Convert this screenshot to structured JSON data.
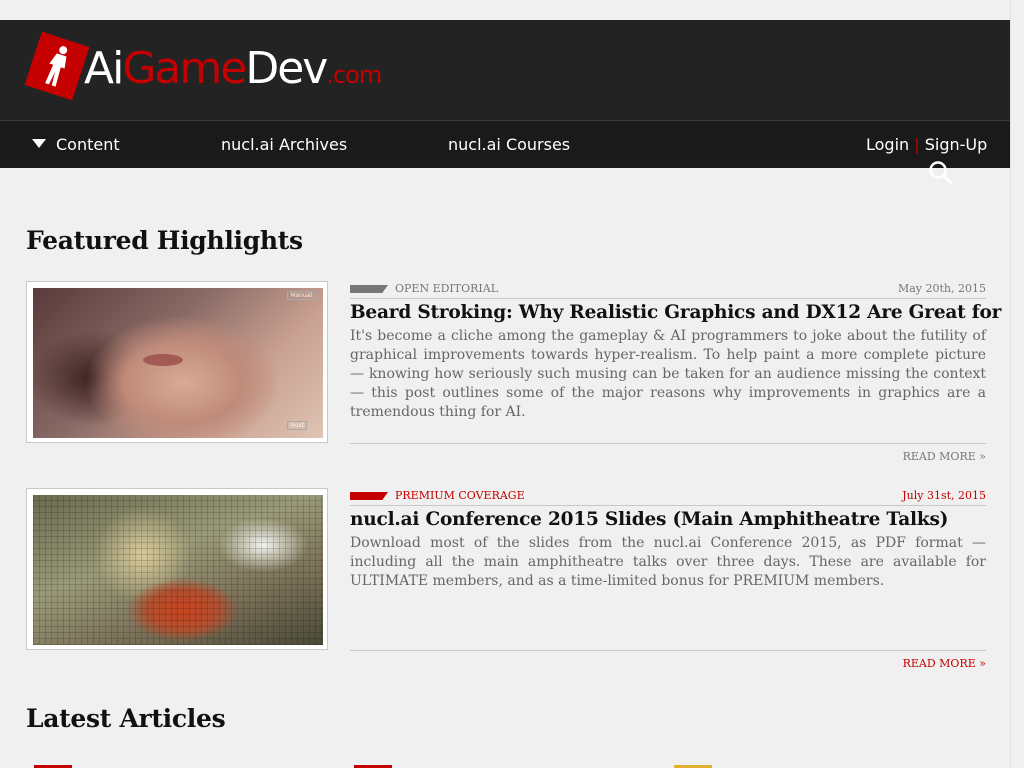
{
  "colors": {
    "brand_red": "#c40000",
    "header_bg": "#232323",
    "nav_bg": "#1a1a1a",
    "page_bg": "#f0f0f0",
    "editorial_gray": "#777777",
    "premium_red": "#c40000"
  },
  "logo": {
    "ai": "Ai",
    "game": "Game",
    "dev": "Dev",
    "com": ".com",
    "icon": "runner-figure-icon"
  },
  "nav": {
    "content": "Content",
    "archives": "nucl.ai Archives",
    "courses": "nucl.ai Courses",
    "login": "Login",
    "separator": "|",
    "signup": "Sign-Up",
    "search_icon": "search-icon"
  },
  "featured": {
    "heading": "Featured Highlights",
    "articles": [
      {
        "category": "OPEN EDITORIAL",
        "date": "May 20th, 2015",
        "title": "Beard Stroking: Why Realistic Graphics and DX12 Are Great for",
        "excerpt": "It's become a cliche among the gameplay & AI programmers to joke about the futility of graphical improvements towards hyper-realism. To help paint a more complete picture — knowing how seriously such musing can be taken for an audience missing the context — this post outlines some of the major reasons why improvements in graphics are a tremendous thing for AI.",
        "read_more": "READ MORE »",
        "thumb_tag_top": "Manual",
        "thumb_tag_bottom": "Next"
      },
      {
        "category": "PREMIUM COVERAGE",
        "date": "July 31st, 2015",
        "title": "nucl.ai Conference 2015 Slides (Main Amphitheatre Talks)",
        "excerpt": "Download most of the slides from the nucl.ai Conference 2015, as PDF format — including all the main amphitheatre talks over three days. These are available for ULTIMATE members, and as a time-limited bonus for PREMIUM members.",
        "read_more": "READ MORE »"
      }
    ]
  },
  "latest": {
    "heading": "Latest Articles"
  }
}
